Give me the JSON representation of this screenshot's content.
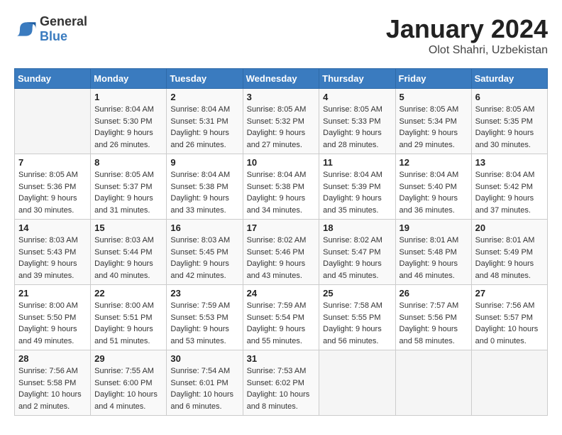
{
  "header": {
    "logo_general": "General",
    "logo_blue": "Blue",
    "month_title": "January 2024",
    "location": "Olot Shahri, Uzbekistan"
  },
  "days_of_week": [
    "Sunday",
    "Monday",
    "Tuesday",
    "Wednesday",
    "Thursday",
    "Friday",
    "Saturday"
  ],
  "weeks": [
    [
      {
        "day": "",
        "sunrise": "",
        "sunset": "",
        "daylight": ""
      },
      {
        "day": "1",
        "sunrise": "Sunrise: 8:04 AM",
        "sunset": "Sunset: 5:30 PM",
        "daylight": "Daylight: 9 hours and 26 minutes."
      },
      {
        "day": "2",
        "sunrise": "Sunrise: 8:04 AM",
        "sunset": "Sunset: 5:31 PM",
        "daylight": "Daylight: 9 hours and 26 minutes."
      },
      {
        "day": "3",
        "sunrise": "Sunrise: 8:05 AM",
        "sunset": "Sunset: 5:32 PM",
        "daylight": "Daylight: 9 hours and 27 minutes."
      },
      {
        "day": "4",
        "sunrise": "Sunrise: 8:05 AM",
        "sunset": "Sunset: 5:33 PM",
        "daylight": "Daylight: 9 hours and 28 minutes."
      },
      {
        "day": "5",
        "sunrise": "Sunrise: 8:05 AM",
        "sunset": "Sunset: 5:34 PM",
        "daylight": "Daylight: 9 hours and 29 minutes."
      },
      {
        "day": "6",
        "sunrise": "Sunrise: 8:05 AM",
        "sunset": "Sunset: 5:35 PM",
        "daylight": "Daylight: 9 hours and 30 minutes."
      }
    ],
    [
      {
        "day": "7",
        "sunrise": "Sunrise: 8:05 AM",
        "sunset": "Sunset: 5:36 PM",
        "daylight": "Daylight: 9 hours and 30 minutes."
      },
      {
        "day": "8",
        "sunrise": "Sunrise: 8:05 AM",
        "sunset": "Sunset: 5:37 PM",
        "daylight": "Daylight: 9 hours and 31 minutes."
      },
      {
        "day": "9",
        "sunrise": "Sunrise: 8:04 AM",
        "sunset": "Sunset: 5:38 PM",
        "daylight": "Daylight: 9 hours and 33 minutes."
      },
      {
        "day": "10",
        "sunrise": "Sunrise: 8:04 AM",
        "sunset": "Sunset: 5:38 PM",
        "daylight": "Daylight: 9 hours and 34 minutes."
      },
      {
        "day": "11",
        "sunrise": "Sunrise: 8:04 AM",
        "sunset": "Sunset: 5:39 PM",
        "daylight": "Daylight: 9 hours and 35 minutes."
      },
      {
        "day": "12",
        "sunrise": "Sunrise: 8:04 AM",
        "sunset": "Sunset: 5:40 PM",
        "daylight": "Daylight: 9 hours and 36 minutes."
      },
      {
        "day": "13",
        "sunrise": "Sunrise: 8:04 AM",
        "sunset": "Sunset: 5:42 PM",
        "daylight": "Daylight: 9 hours and 37 minutes."
      }
    ],
    [
      {
        "day": "14",
        "sunrise": "Sunrise: 8:03 AM",
        "sunset": "Sunset: 5:43 PM",
        "daylight": "Daylight: 9 hours and 39 minutes."
      },
      {
        "day": "15",
        "sunrise": "Sunrise: 8:03 AM",
        "sunset": "Sunset: 5:44 PM",
        "daylight": "Daylight: 9 hours and 40 minutes."
      },
      {
        "day": "16",
        "sunrise": "Sunrise: 8:03 AM",
        "sunset": "Sunset: 5:45 PM",
        "daylight": "Daylight: 9 hours and 42 minutes."
      },
      {
        "day": "17",
        "sunrise": "Sunrise: 8:02 AM",
        "sunset": "Sunset: 5:46 PM",
        "daylight": "Daylight: 9 hours and 43 minutes."
      },
      {
        "day": "18",
        "sunrise": "Sunrise: 8:02 AM",
        "sunset": "Sunset: 5:47 PM",
        "daylight": "Daylight: 9 hours and 45 minutes."
      },
      {
        "day": "19",
        "sunrise": "Sunrise: 8:01 AM",
        "sunset": "Sunset: 5:48 PM",
        "daylight": "Daylight: 9 hours and 46 minutes."
      },
      {
        "day": "20",
        "sunrise": "Sunrise: 8:01 AM",
        "sunset": "Sunset: 5:49 PM",
        "daylight": "Daylight: 9 hours and 48 minutes."
      }
    ],
    [
      {
        "day": "21",
        "sunrise": "Sunrise: 8:00 AM",
        "sunset": "Sunset: 5:50 PM",
        "daylight": "Daylight: 9 hours and 49 minutes."
      },
      {
        "day": "22",
        "sunrise": "Sunrise: 8:00 AM",
        "sunset": "Sunset: 5:51 PM",
        "daylight": "Daylight: 9 hours and 51 minutes."
      },
      {
        "day": "23",
        "sunrise": "Sunrise: 7:59 AM",
        "sunset": "Sunset: 5:53 PM",
        "daylight": "Daylight: 9 hours and 53 minutes."
      },
      {
        "day": "24",
        "sunrise": "Sunrise: 7:59 AM",
        "sunset": "Sunset: 5:54 PM",
        "daylight": "Daylight: 9 hours and 55 minutes."
      },
      {
        "day": "25",
        "sunrise": "Sunrise: 7:58 AM",
        "sunset": "Sunset: 5:55 PM",
        "daylight": "Daylight: 9 hours and 56 minutes."
      },
      {
        "day": "26",
        "sunrise": "Sunrise: 7:57 AM",
        "sunset": "Sunset: 5:56 PM",
        "daylight": "Daylight: 9 hours and 58 minutes."
      },
      {
        "day": "27",
        "sunrise": "Sunrise: 7:56 AM",
        "sunset": "Sunset: 5:57 PM",
        "daylight": "Daylight: 10 hours and 0 minutes."
      }
    ],
    [
      {
        "day": "28",
        "sunrise": "Sunrise: 7:56 AM",
        "sunset": "Sunset: 5:58 PM",
        "daylight": "Daylight: 10 hours and 2 minutes."
      },
      {
        "day": "29",
        "sunrise": "Sunrise: 7:55 AM",
        "sunset": "Sunset: 6:00 PM",
        "daylight": "Daylight: 10 hours and 4 minutes."
      },
      {
        "day": "30",
        "sunrise": "Sunrise: 7:54 AM",
        "sunset": "Sunset: 6:01 PM",
        "daylight": "Daylight: 10 hours and 6 minutes."
      },
      {
        "day": "31",
        "sunrise": "Sunrise: 7:53 AM",
        "sunset": "Sunset: 6:02 PM",
        "daylight": "Daylight: 10 hours and 8 minutes."
      },
      {
        "day": "",
        "sunrise": "",
        "sunset": "",
        "daylight": ""
      },
      {
        "day": "",
        "sunrise": "",
        "sunset": "",
        "daylight": ""
      },
      {
        "day": "",
        "sunrise": "",
        "sunset": "",
        "daylight": ""
      }
    ]
  ]
}
